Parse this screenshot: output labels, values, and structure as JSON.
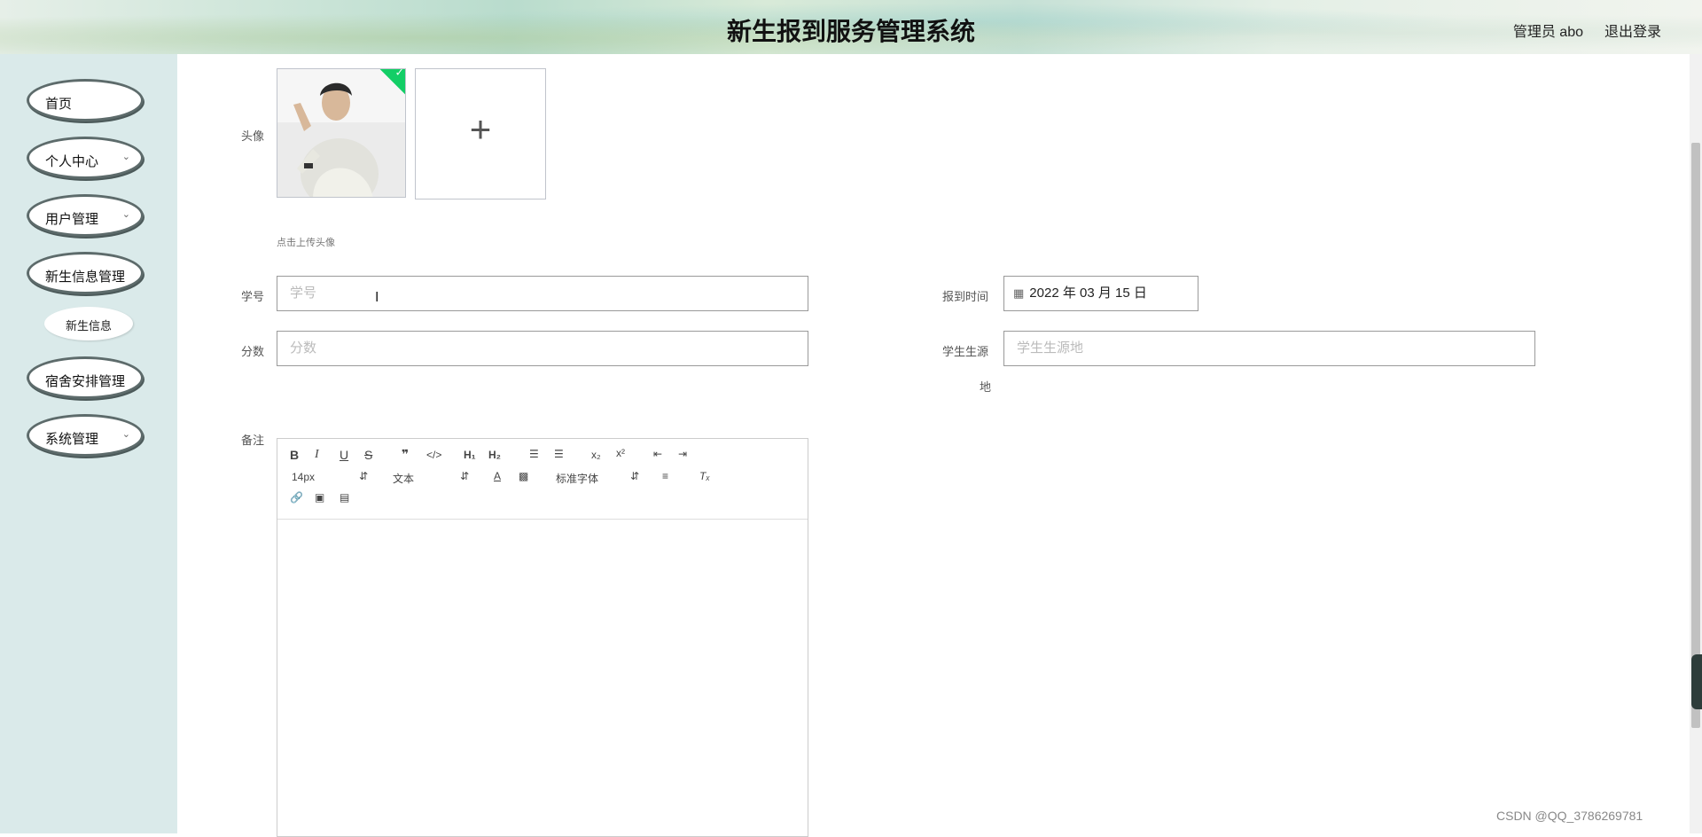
{
  "header": {
    "title": "新生报到服务管理系统",
    "user": "管理员 abo",
    "logout": "退出登录"
  },
  "sidebar": {
    "items": [
      {
        "label": "首页",
        "chevron": false
      },
      {
        "label": "个人中心",
        "chevron": true
      },
      {
        "label": "用户管理",
        "chevron": true
      },
      {
        "label": "新生信息管理",
        "chevron": false
      },
      {
        "label": "宿舍安排管理",
        "chevron": false
      },
      {
        "label": "系统管理",
        "chevron": true
      }
    ],
    "submenu": {
      "label": "新生信息"
    }
  },
  "form": {
    "avatar_label": "头像",
    "upload_tip": "点击上传头像",
    "student_id_label": "学号",
    "student_id_placeholder": "学号",
    "score_label": "分数",
    "score_placeholder": "分数",
    "register_time_label": "报到时间",
    "register_time_value": "2022 年 03 月 15 日",
    "origin_label_line1": "学生生源",
    "origin_label_line2": "地",
    "origin_placeholder": "学生生源地",
    "notes_label": "备注"
  },
  "editor": {
    "font_size": "14px",
    "text_style": "文本",
    "font_family": "标准字体"
  },
  "watermark": "CSDN @QQ_3786269781"
}
